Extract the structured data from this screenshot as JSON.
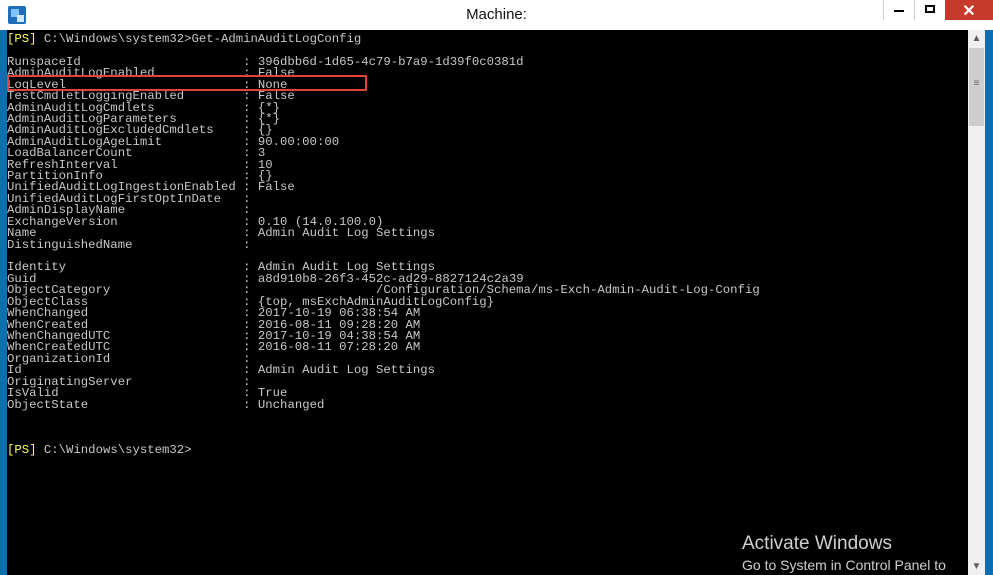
{
  "window": {
    "title": "Machine:",
    "close_glyph": "✕",
    "icon": "exchange-shell-icon",
    "accent": "#0b6fb0",
    "close_color": "#c7392b"
  },
  "console": {
    "prompt_tag": "[PS]",
    "command_line": " C:\\Windows\\system32>Get-AdminAuditLogConfig",
    "second_prompt_path": " C:\\Windows\\system32>",
    "rows": [
      {
        "label": "",
        "value": ""
      },
      {
        "label": "RunspaceId",
        "value": "396dbb6d-1d65-4c79-b7a9-1d39f0c0381d"
      },
      {
        "label": "AdminAuditLogEnabled",
        "value": "False"
      },
      {
        "label": "LogLevel",
        "value": "None"
      },
      {
        "label": "TestCmdletLoggingEnabled",
        "value": "False"
      },
      {
        "label": "AdminAuditLogCmdlets",
        "value": "{*}"
      },
      {
        "label": "AdminAuditLogParameters",
        "value": "{*}"
      },
      {
        "label": "AdminAuditLogExcludedCmdlets",
        "value": "{}"
      },
      {
        "label": "AdminAuditLogAgeLimit",
        "value": "90.00:00:00"
      },
      {
        "label": "LoadBalancerCount",
        "value": "3"
      },
      {
        "label": "RefreshInterval",
        "value": "10"
      },
      {
        "label": "PartitionInfo",
        "value": "{}"
      },
      {
        "label": "UnifiedAuditLogIngestionEnabled",
        "value": "False"
      },
      {
        "label": "UnifiedAuditLogFirstOptInDate",
        "value": ""
      },
      {
        "label": "AdminDisplayName",
        "value": ""
      },
      {
        "label": "ExchangeVersion",
        "value": "0.10 (14.0.100.0)"
      },
      {
        "label": "Name",
        "value": "Admin Audit Log Settings"
      },
      {
        "label": "DistinguishedName",
        "value": ""
      },
      {
        "label": "",
        "value": ""
      },
      {
        "label": "Identity",
        "value": "Admin Audit Log Settings"
      },
      {
        "label": "Guid",
        "value": "a8d910b8-26f3-452c-ad29-8827124c2a39"
      },
      {
        "label": "ObjectCategory",
        "value": "                /Configuration/Schema/ms-Exch-Admin-Audit-Log-Config"
      },
      {
        "label": "ObjectClass",
        "value": "{top, msExchAdminAuditLogConfig}"
      },
      {
        "label": "WhenChanged",
        "value": "2017-10-19 06:38:54 AM"
      },
      {
        "label": "WhenCreated",
        "value": "2016-08-11 09:28:20 AM"
      },
      {
        "label": "WhenChangedUTC",
        "value": "2017-10-19 04:38:54 AM"
      },
      {
        "label": "WhenCreatedUTC",
        "value": "2016-08-11 07:28:20 AM"
      },
      {
        "label": "OrganizationId",
        "value": ""
      },
      {
        "label": "Id",
        "value": "Admin Audit Log Settings"
      },
      {
        "label": "OriginatingServer",
        "value": ""
      },
      {
        "label": "IsValid",
        "value": "True"
      },
      {
        "label": "ObjectState",
        "value": "Unchanged"
      }
    ],
    "highlighted_property": "AdminAuditLogEnabled",
    "highlight_color": "#e0443a",
    "prompt_color": "#ffff55"
  },
  "watermark": {
    "title": "Activate Windows",
    "subtitle": "Go to System in Control Panel to"
  }
}
